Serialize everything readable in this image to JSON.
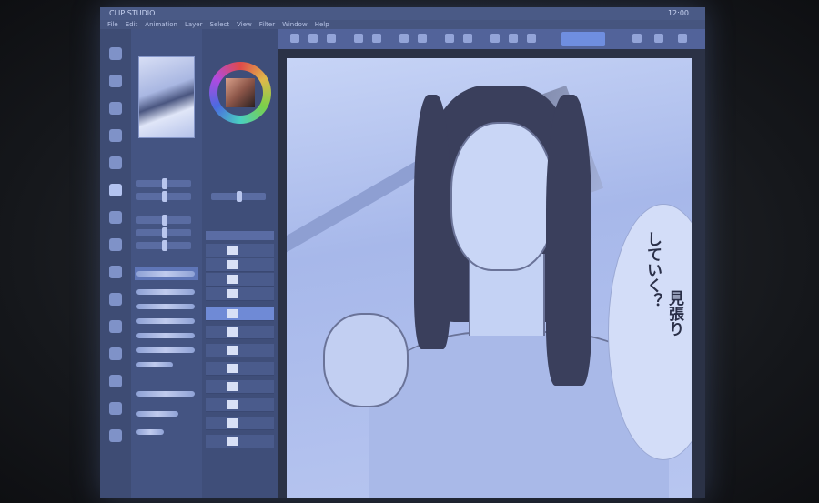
{
  "window": {
    "title": "CLIP STUDIO",
    "clock": "12:00"
  },
  "menu": {
    "items": [
      "File",
      "Edit",
      "Animation",
      "Layer",
      "Select",
      "View",
      "Filter",
      "Window",
      "Help"
    ]
  },
  "colors": {
    "accent": "#6f8ee0",
    "screen_glow": "#7a96e6",
    "canvas": "#b8c6f0"
  },
  "canvas": {
    "speech_text": [
      "していく？",
      "見張り"
    ]
  },
  "toolbar": {
    "icons": [
      "new-icon",
      "open-icon",
      "save-icon",
      "undo-icon",
      "redo-icon",
      "clear-icon",
      "transform-icon",
      "deselect-icon",
      "invert-icon",
      "snap-icon",
      "ruler-icon",
      "grid-icon",
      "zoom-icon",
      "rotate-icon",
      "flip-icon"
    ]
  },
  "tools": {
    "icons": [
      "zoom-icon",
      "move-icon",
      "select-icon",
      "eyedropper-icon",
      "pen-icon",
      "brush-icon",
      "eraser-icon",
      "fill-icon",
      "gradient-icon",
      "figure-icon",
      "frame-icon",
      "text-icon",
      "balloon-icon",
      "ruler-icon",
      "correct-icon"
    ]
  },
  "layers": {
    "count": 15,
    "selected_index": 4
  }
}
